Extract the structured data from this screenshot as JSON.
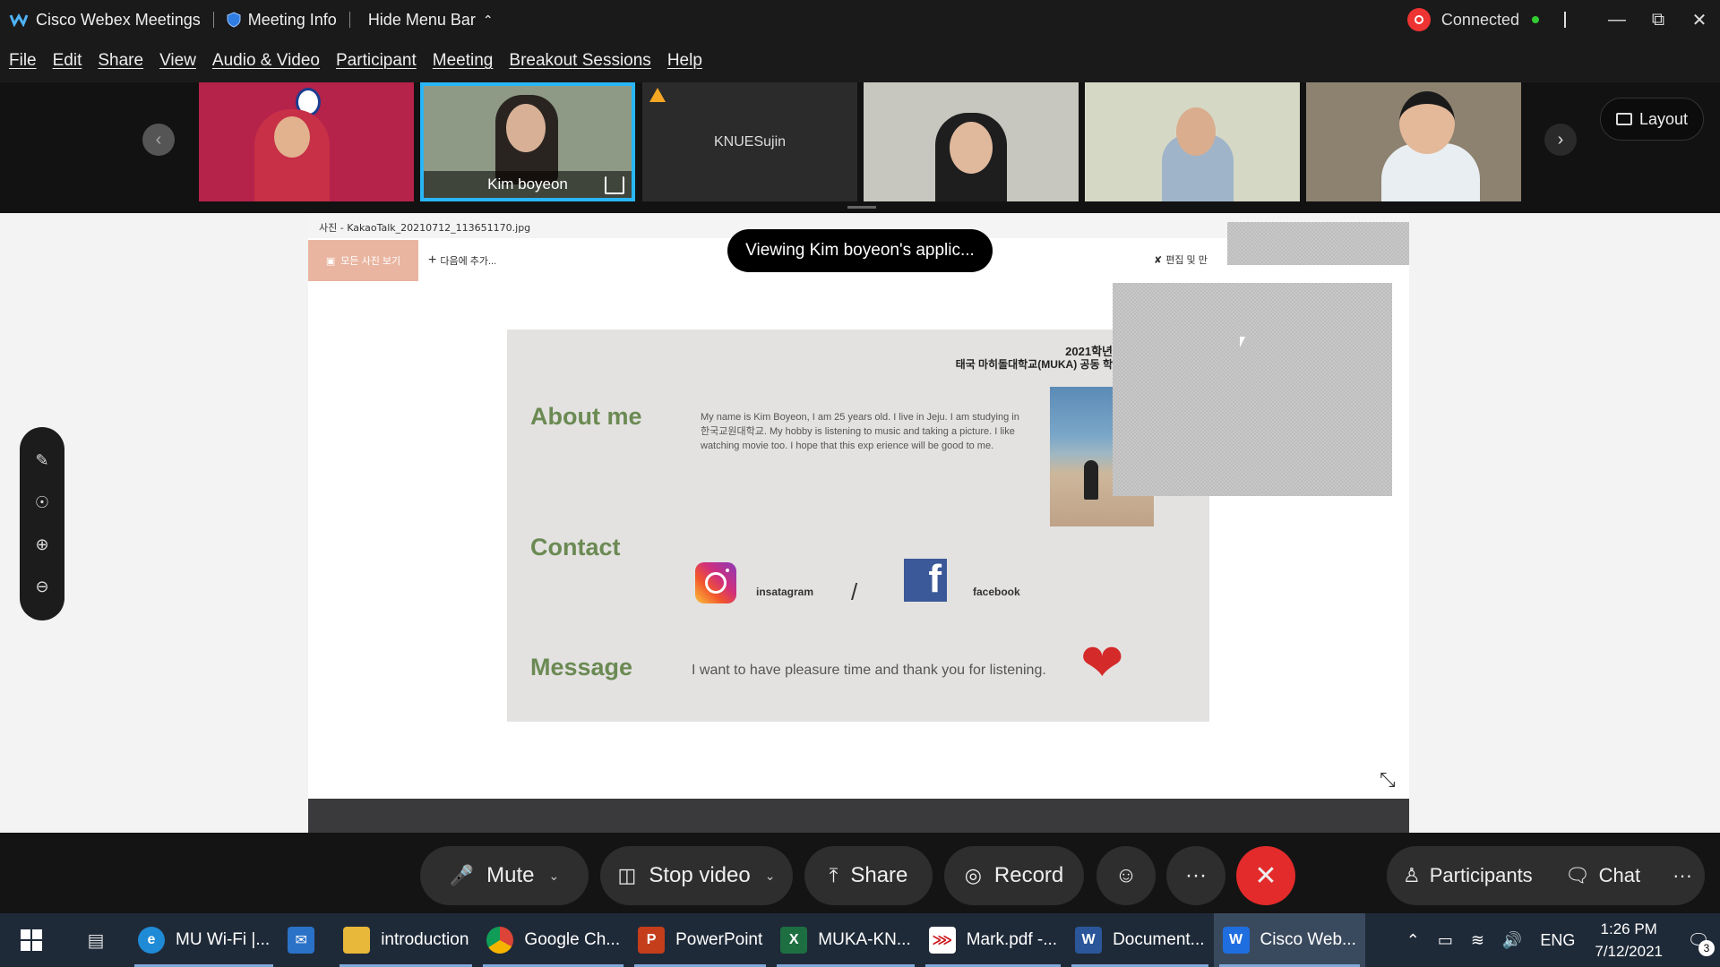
{
  "titlebar": {
    "app_name": "Cisco Webex Meetings",
    "meeting_info": "Meeting Info",
    "hide_menu": "Hide Menu Bar",
    "status": "Connected"
  },
  "menu": [
    "File",
    "Edit",
    "Share",
    "View",
    "Audio & Video",
    "Participant",
    "Meeting",
    "Breakout Sessions",
    "Help"
  ],
  "participants_strip": {
    "tiles": [
      {
        "name": "",
        "bg": "#b5224a"
      },
      {
        "name": "Kim boyeon",
        "bg": "#8e9a86",
        "active": true
      },
      {
        "name": "KNUESujin",
        "bg": "#2b2b2b"
      },
      {
        "name": "",
        "bg": "#c8c7bf"
      },
      {
        "name": "",
        "bg": "#d6d8c6"
      },
      {
        "name": "",
        "bg": "#8d8270"
      }
    ],
    "layout_label": "Layout"
  },
  "viewer": {
    "file_title": "사진 - KakaoTalk_20210712_113651170.jpg",
    "all_photos": "모든 사진 보기",
    "add_later": "다음에 추가...",
    "edit": "편집 및 만",
    "toast": "Viewing Kim boyeon's applic..."
  },
  "slide": {
    "header_line1": "2021학년",
    "header_line2": "태국 마히돌대학교(MUKA) 공동 학",
    "about_title": "About me",
    "about_text": "My name is Kim Boyeon, I am 25 years old. I live in Jeju. I am studying in 한국교원대학교. My hobby is listening to music and taking a picture. I like watching movie too. I hope that this exp erience will be good to me.",
    "contact_title": "Contact",
    "instagram_label": "insatagram",
    "slash": "/",
    "facebook_label": "facebook",
    "facebook_glyph": "f",
    "message_title": "Message",
    "message_text": "I want to have pleasure time and thank you for listening."
  },
  "controls": {
    "mute": "Mute",
    "stop_video": "Stop video",
    "share": "Share",
    "record": "Record",
    "more": "···",
    "participants": "Participants",
    "chat": "Chat"
  },
  "taskbar": {
    "apps": [
      {
        "label": "MU Wi-Fi |...",
        "icon": "edge-icon",
        "color": "#1f8ad6"
      },
      {
        "label": "",
        "icon": "mail-icon",
        "color": "#2a72c8"
      },
      {
        "label": "introduction",
        "icon": "folder-icon",
        "color": "#e8b83a"
      },
      {
        "label": "Google Ch...",
        "icon": "chrome-icon",
        "color": "#db4437"
      },
      {
        "label": "PowerPoint",
        "icon": "powerpoint-icon",
        "color": "#c43e1c"
      },
      {
        "label": "MUKA-KN...",
        "icon": "excel-icon",
        "color": "#1d6f42"
      },
      {
        "label": "Mark.pdf -...",
        "icon": "pdf-icon",
        "color": "#c9161d"
      },
      {
        "label": "Document...",
        "icon": "word-icon",
        "color": "#2b579a"
      },
      {
        "label": "Cisco Web...",
        "icon": "webex-icon",
        "color": "#1e6ee0"
      }
    ],
    "lang": "ENG",
    "time": "1:26 PM",
    "date": "7/12/2021",
    "notifications": "3"
  }
}
